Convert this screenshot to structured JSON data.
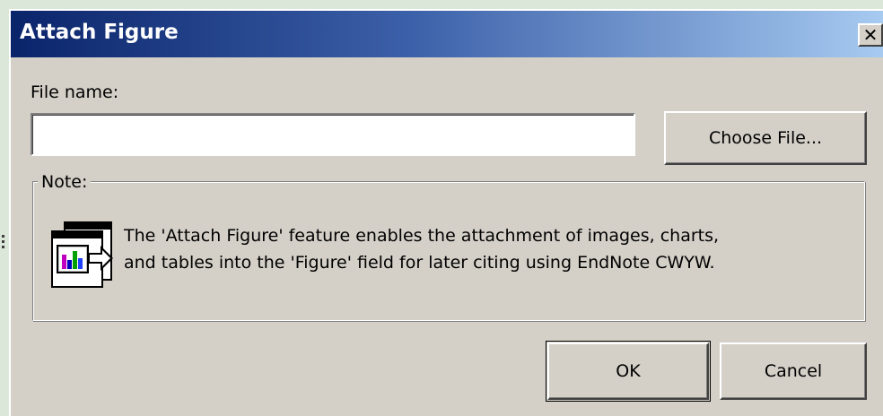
{
  "dialog": {
    "title": "Attach Figure",
    "close_label": "✕"
  },
  "file": {
    "label": "File name:",
    "value": "",
    "placeholder": "",
    "choose_label": "Choose File..."
  },
  "note": {
    "legend": "Note:",
    "icon": "attach-figure-icon",
    "line1": "The 'Attach Figure' feature enables the attachment of images, charts,",
    "line2": "and tables into the 'Figure' field for later citing using EndNote CWYW."
  },
  "actions": {
    "ok_label": "OK",
    "cancel_label": "Cancel"
  },
  "colors": {
    "title_gradient_start": "#0a246a",
    "title_gradient_end": "#a6caf0",
    "face": "#d4d0c8"
  }
}
